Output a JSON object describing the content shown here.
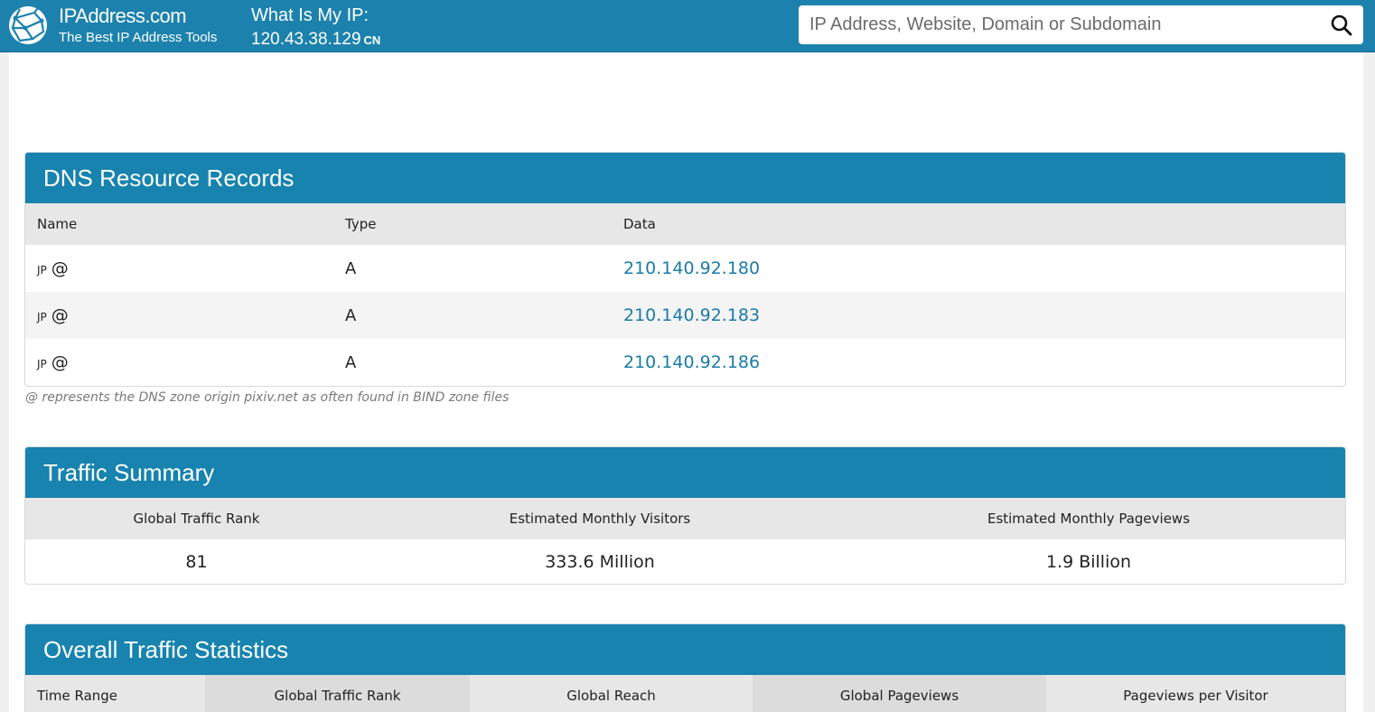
{
  "header": {
    "brand_name": "IPAddress.com",
    "brand_tagline": "The Best IP Address Tools",
    "myip_label": "What Is My IP:",
    "myip_value": "120.43.38.129",
    "myip_country": "CN",
    "search_placeholder": "IP Address, Website, Domain or Subdomain",
    "search_value": "",
    "search_icon": "search-icon"
  },
  "dns": {
    "title": "DNS Resource Records",
    "columns": [
      "Name",
      "Type",
      "Data"
    ],
    "rows": [
      {
        "country": "JP",
        "name": "@",
        "type": "A",
        "data": "210.140.92.180"
      },
      {
        "country": "JP",
        "name": "@",
        "type": "A",
        "data": "210.140.92.183"
      },
      {
        "country": "JP",
        "name": "@",
        "type": "A",
        "data": "210.140.92.186"
      }
    ],
    "note": "@ represents the DNS zone origin pixiv.net as often found in BIND zone files"
  },
  "traffic_summary": {
    "title": "Traffic Summary",
    "columns": [
      "Global Traffic Rank",
      "Estimated Monthly Visitors",
      "Estimated Monthly Pageviews"
    ],
    "values": [
      "81",
      "333.6 Million",
      "1.9 Billion"
    ]
  },
  "overall_traffic": {
    "title": "Overall Traffic Statistics",
    "columns": [
      "Time Range",
      "Global Traffic Rank",
      "Global Reach",
      "Global Pageviews",
      "Pageviews per Visitor"
    ]
  },
  "colors": {
    "header_bg": "#1c82ad",
    "card_head_bg": "#1783ae",
    "link": "#1a7ba8"
  }
}
